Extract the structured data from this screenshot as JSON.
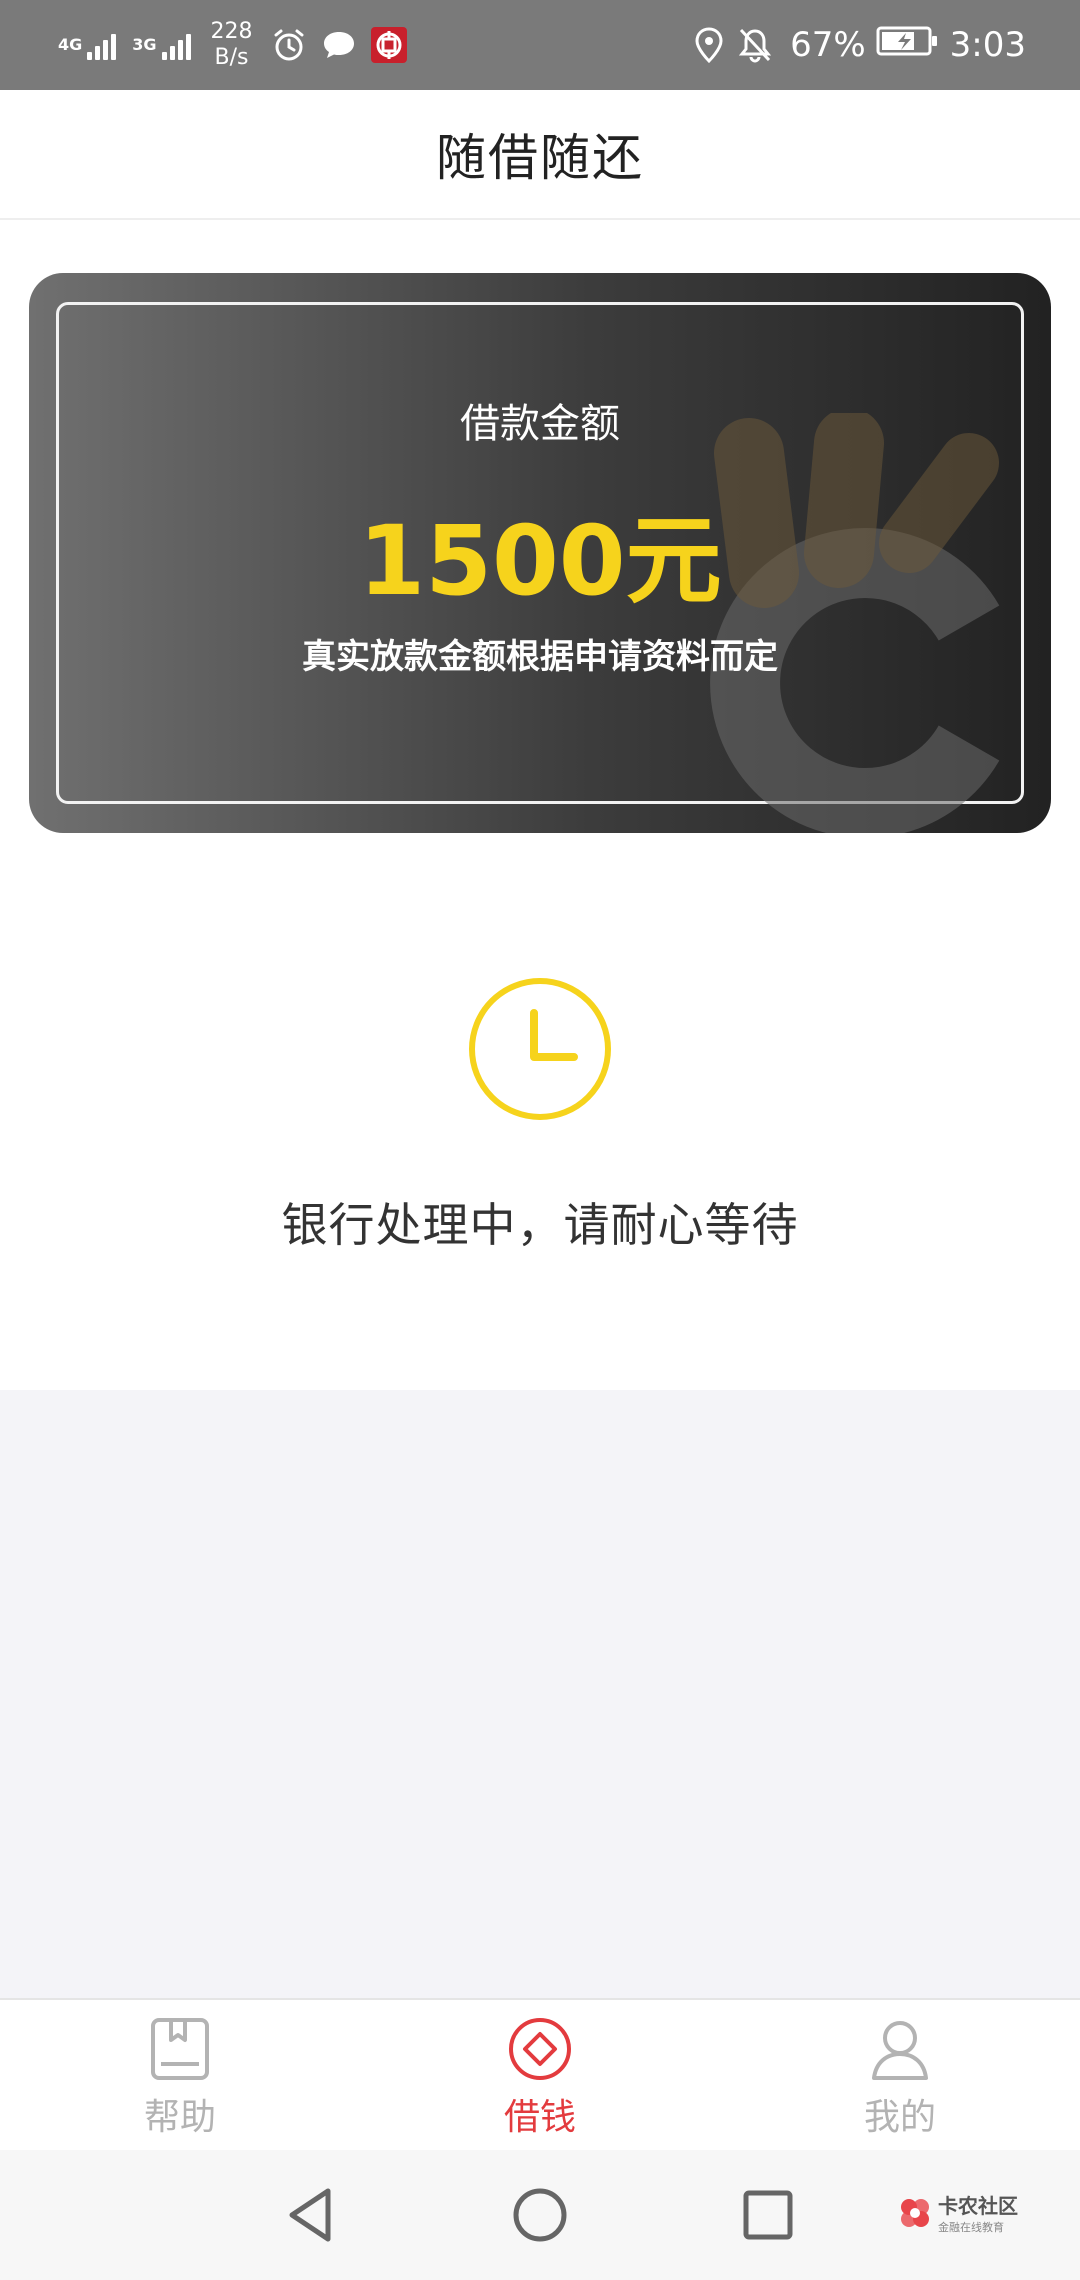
{
  "status_bar": {
    "signal1_label": "4G",
    "signal2_label": "3G",
    "speed_value": "228",
    "speed_unit": "B/s",
    "battery_percent": "67%",
    "time": "3:03"
  },
  "header": {
    "title": "随借随还"
  },
  "loan_card": {
    "label": "借款金额",
    "amount": "1500元",
    "note": "真实放款金额根据申请资料而定"
  },
  "processing": {
    "message": "银行处理中，请耐心等待"
  },
  "bottom_nav": {
    "items": [
      {
        "label": "帮助",
        "icon": "help-book-icon",
        "active": false
      },
      {
        "label": "借钱",
        "icon": "borrow-diamond-icon",
        "active": true
      },
      {
        "label": "我的",
        "icon": "profile-person-icon",
        "active": false
      }
    ]
  },
  "watermark": {
    "title": "卡农社区",
    "subtitle": "金融在线教育"
  },
  "colors": {
    "accent_yellow": "#f6d31c",
    "active_red": "#e33b3e",
    "inactive_gray": "#b3b3b3",
    "status_bar_gray": "#7a7a7a"
  }
}
